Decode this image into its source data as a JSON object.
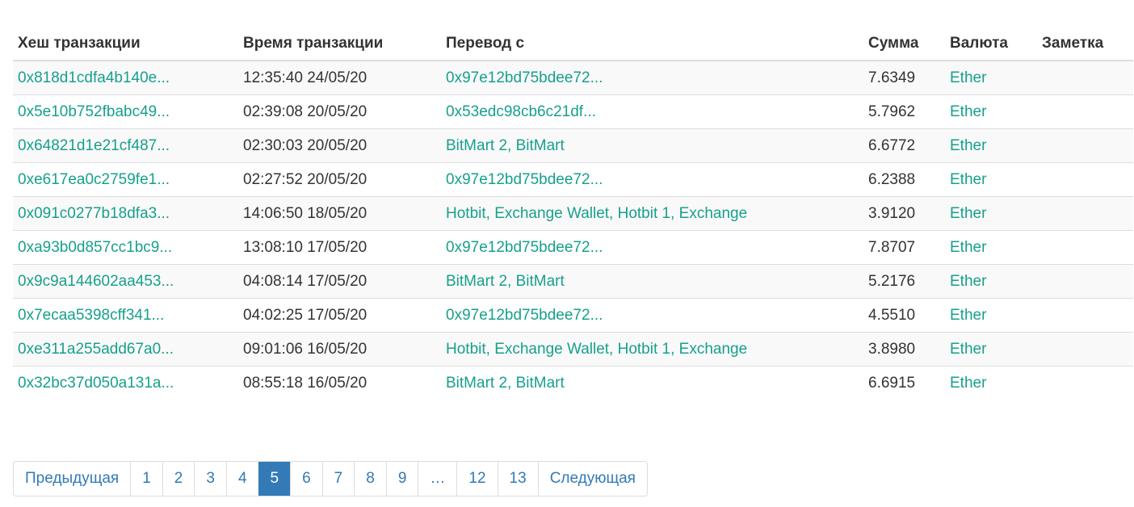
{
  "table": {
    "headers": {
      "hash": "Хеш транзакции",
      "time": "Время транзакции",
      "from": "Перевод с",
      "amount": "Сумма",
      "currency": "Валюта",
      "note": "Заметка"
    },
    "rows": [
      {
        "hash": "0x818d1cdfa4b140e...",
        "time": "12:35:40 24/05/20",
        "from": "0x97e12bd75bdee72...",
        "amount": "7.6349",
        "currency": "Ether",
        "note": ""
      },
      {
        "hash": "0x5e10b752fbabc49...",
        "time": "02:39:08 20/05/20",
        "from": "0x53edc98cb6c21df...",
        "amount": "5.7962",
        "currency": "Ether",
        "note": ""
      },
      {
        "hash": "0x64821d1e21cf487...",
        "time": "02:30:03 20/05/20",
        "from": "BitMart 2, BitMart",
        "amount": "6.6772",
        "currency": "Ether",
        "note": ""
      },
      {
        "hash": "0xe617ea0c2759fe1...",
        "time": "02:27:52 20/05/20",
        "from": "0x97e12bd75bdee72...",
        "amount": "6.2388",
        "currency": "Ether",
        "note": ""
      },
      {
        "hash": "0x091c0277b18dfa3...",
        "time": "14:06:50 18/05/20",
        "from": "Hotbit, Exchange Wallet, Hotbit 1, Exchange",
        "amount": "3.9120",
        "currency": "Ether",
        "note": ""
      },
      {
        "hash": "0xa93b0d857cc1bc9...",
        "time": "13:08:10 17/05/20",
        "from": "0x97e12bd75bdee72...",
        "amount": "7.8707",
        "currency": "Ether",
        "note": ""
      },
      {
        "hash": "0x9c9a144602aa453...",
        "time": "04:08:14 17/05/20",
        "from": "BitMart 2, BitMart",
        "amount": "5.2176",
        "currency": "Ether",
        "note": ""
      },
      {
        "hash": "0x7ecaa5398cff341...",
        "time": "04:02:25 17/05/20",
        "from": "0x97e12bd75bdee72...",
        "amount": "4.5510",
        "currency": "Ether",
        "note": ""
      },
      {
        "hash": "0xe311a255add67a0...",
        "time": "09:01:06 16/05/20",
        "from": "Hotbit, Exchange Wallet, Hotbit 1, Exchange",
        "amount": "3.8980",
        "currency": "Ether",
        "note": ""
      },
      {
        "hash": "0x32bc37d050a131a...",
        "time": "08:55:18 16/05/20",
        "from": "BitMart 2, BitMart",
        "amount": "6.6915",
        "currency": "Ether",
        "note": ""
      }
    ]
  },
  "pagination": {
    "prev": "Предыдущая",
    "next": "Следующая",
    "pages": [
      "1",
      "2",
      "3",
      "4",
      "5",
      "6",
      "7",
      "8",
      "9",
      "…",
      "12",
      "13"
    ],
    "current": "5"
  },
  "colors": {
    "link": "#17a08c",
    "pager_link": "#337ab7",
    "pager_active_bg": "#337ab7",
    "row_stripe": "#f9f9f9",
    "border": "#dddddd"
  }
}
